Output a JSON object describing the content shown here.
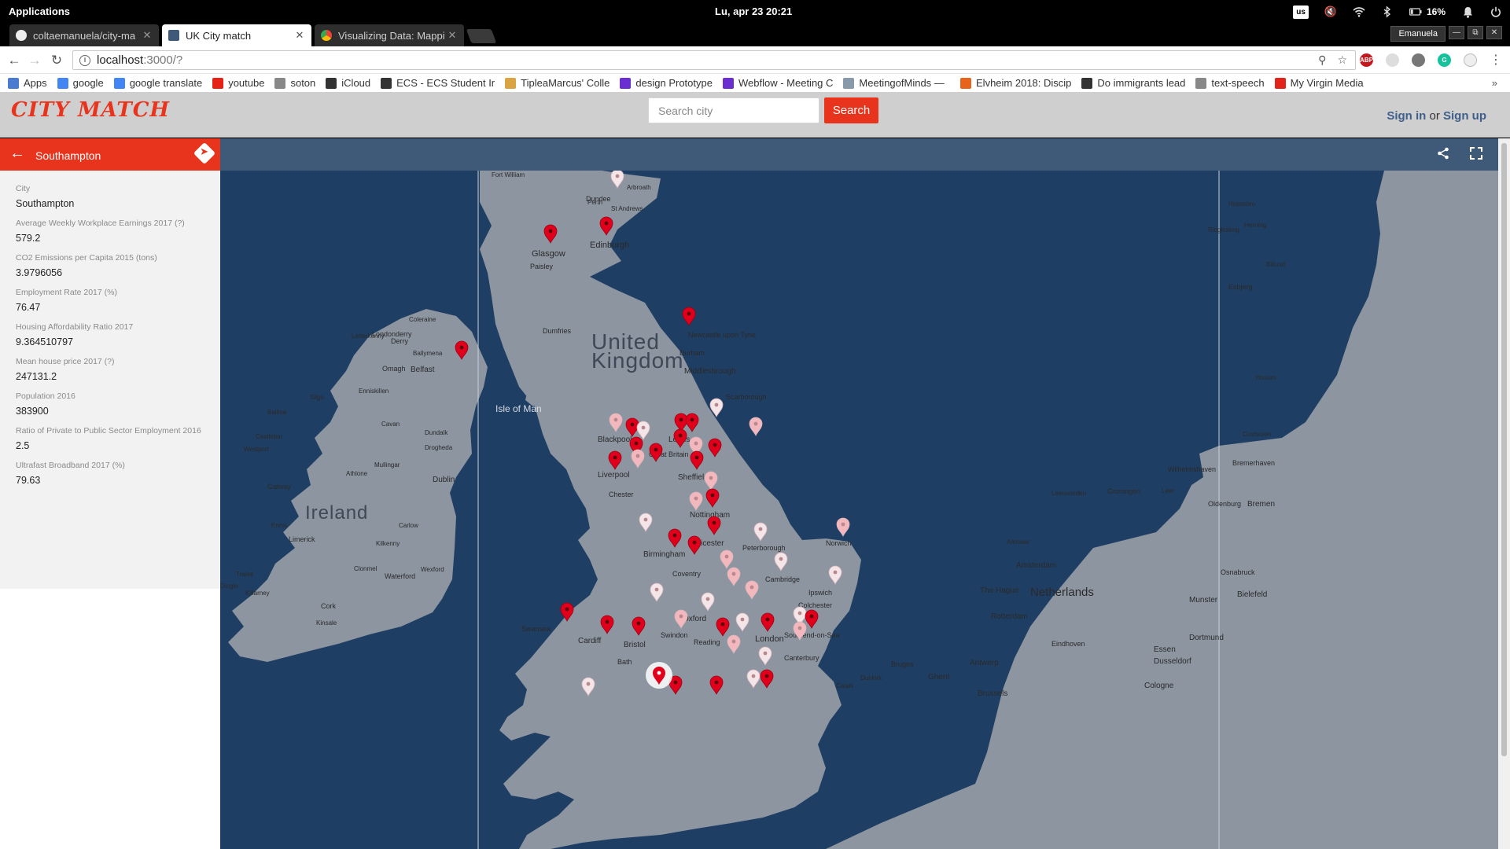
{
  "os": {
    "apps_label": "Applications",
    "datetime": "Lu, apr 23    20:21",
    "keyboard": "us",
    "battery": "16%"
  },
  "tabs": [
    {
      "title": "coltaemanuela/city-ma",
      "active": false
    },
    {
      "title": "UK City match",
      "active": true
    },
    {
      "title": "Visualizing Data: Mappi",
      "active": false
    }
  ],
  "window": {
    "user": "Emanuela"
  },
  "address": {
    "host": "localhost",
    "path": ":3000/?"
  },
  "bookmarks": [
    {
      "label": "Apps",
      "icon": "apps-grid-icon",
      "color": "#4a7bd0"
    },
    {
      "label": "google",
      "icon": "google-icon",
      "color": "#4285f4"
    },
    {
      "label": "google translate",
      "icon": "translate-icon",
      "color": "#4285f4"
    },
    {
      "label": "youtube",
      "icon": "youtube-icon",
      "color": "#e62117"
    },
    {
      "label": "soton",
      "icon": "page-icon",
      "color": "#888888"
    },
    {
      "label": "iCloud",
      "icon": "apple-icon",
      "color": "#333333"
    },
    {
      "label": "ECS - ECS Student Ir",
      "icon": "ecs-icon",
      "color": "#333333"
    },
    {
      "label": "TipleaMarcus' Colle",
      "icon": "bookmark-icon",
      "color": "#d9a441"
    },
    {
      "label": "design Prototype",
      "icon": "webflow-icon",
      "color": "#6b2fd1"
    },
    {
      "label": "Webflow - Meeting C",
      "icon": "webflow-icon",
      "color": "#6b2fd1"
    },
    {
      "label": "MeetingofMinds —  ",
      "icon": "globe-icon",
      "color": "#8899aa"
    },
    {
      "label": "Elvheim 2018: Discip",
      "icon": "bookmark-icon",
      "color": "#e8631c"
    },
    {
      "label": "Do immigrants lead",
      "icon": "chart-icon",
      "color": "#333333"
    },
    {
      "label": "text-speech",
      "icon": "page-icon",
      "color": "#888888"
    },
    {
      "label": "My Virgin Media",
      "icon": "virgin-icon",
      "color": "#e2231a"
    }
  ],
  "header": {
    "logo": "CITY MATCH",
    "search_placeholder": "Search city",
    "search_button": "Search",
    "sign_in": "Sign in",
    "or": "or",
    "sign_up": "Sign up"
  },
  "sidebar": {
    "title": "Southampton",
    "properties": [
      {
        "label": "City",
        "value": "Southampton"
      },
      {
        "label": "Average Weekly Workplace Earnings 2017 (?)",
        "value": "579.2"
      },
      {
        "label": "CO2 Emissions per Capita 2015 (tons)",
        "value": "3.9796056"
      },
      {
        "label": "Employment Rate 2017 (%)",
        "value": "76.47"
      },
      {
        "label": "Housing Affordability Ratio 2017",
        "value": "9.364510797"
      },
      {
        "label": "Mean house price 2017 (?)",
        "value": "247131.2"
      },
      {
        "label": "Population 2016",
        "value": "383900"
      },
      {
        "label": "Ratio of Private to Public Sector Employment 2016",
        "value": "2.5"
      },
      {
        "label": "Ultrafast Broadband 2017 (%)",
        "value": "79.63"
      }
    ]
  },
  "map": {
    "colors": {
      "sea": "#1f3e63",
      "land": "#8c95a0",
      "pin_red": "#e0001b",
      "pin_pale": "#f2b8bd",
      "pin_white": "#f4e6e8"
    },
    "country_labels": [
      "United",
      "Kingdom",
      "Ireland",
      "Netherlands",
      "Isle of Man"
    ],
    "city_labels": [
      "Glasgow",
      "Paisley",
      "Edinburgh",
      "Dundee",
      "St Andrews",
      "Perth",
      "Arbroath",
      "Fort William",
      "Dumfries",
      "Newcastle upon Tyne",
      "Durham",
      "Middlesbrough",
      "Scarborough",
      "Blackpool",
      "Great Britain",
      "Leeds",
      "Liverpool",
      "Chester",
      "Sheffield",
      "Nottingham",
      "Birmingham",
      "Leicester",
      "Coventry",
      "Peterborough",
      "Norwich",
      "Cambridge",
      "Ipswich",
      "Colchester",
      "Oxford",
      "Swansea",
      "Cardiff",
      "Bristol",
      "Bath",
      "Swindon",
      "Reading",
      "London",
      "Southend-on-Sea",
      "Canterbury",
      "Belfast",
      "Londonderry",
      "Derry",
      "Coleraine",
      "Letterkenny",
      "Ballymena",
      "Omagh",
      "Enniskillen",
      "Sligo",
      "Ballina",
      "Castlebar",
      "Westport",
      "Cavan",
      "Dundalk",
      "Drogheda",
      "Mullingar",
      "Athlone",
      "Galway",
      "Dublin",
      "Ennis",
      "Limerick",
      "Carlow",
      "Kilkenny",
      "Tralee",
      "Clonmel",
      "Waterford",
      "Wexford",
      "Killarney",
      "Cork",
      "Kinsale",
      "Dingle",
      "Amsterdam",
      "The Hague",
      "Rotterdam",
      "Antwerp",
      "Ghent",
      "Bruges",
      "Brussels",
      "Dunkirk",
      "Calais",
      "Eindhoven",
      "Dusseldorf",
      "Essen",
      "Dortmund",
      "Cologne",
      "Bielefeld",
      "Munster",
      "Osnabruck",
      "Oldenburg",
      "Bremen",
      "Bremerhaven",
      "Wilhelmshaven",
      "Leer",
      "Groningen",
      "Leeuwarden",
      "Alkmaar",
      "Cuxhaven",
      "Husum",
      "Esbjerg",
      "Herning",
      "Holstebro",
      "Ringkobing",
      "Billund"
    ]
  }
}
